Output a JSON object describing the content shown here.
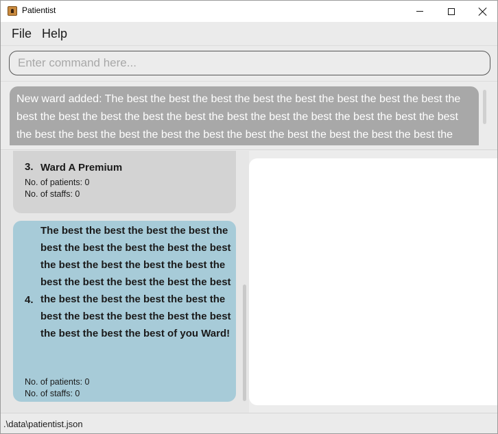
{
  "window": {
    "title": "Patientist",
    "icon": "app-icon"
  },
  "menu": {
    "file": "File",
    "help": "Help"
  },
  "command": {
    "placeholder": "Enter command here...",
    "value": ""
  },
  "result": {
    "text": "New ward added: The best the best the best the best the best the best the best the best the best the best the best the best the best the best the best the best the best the best the best the best the best the best the best the best the best the best the best the best the best the best of you Ward!"
  },
  "wards": [
    {
      "index": "3.",
      "name": "Ward A Premium",
      "patients_label": "No. of patients: 0",
      "staffs_label": "No. of staffs: 0"
    },
    {
      "index": "4.",
      "name": "The best the best the best the best the best the best the best the best the best the best the best the best the best the best the best the best the best the best the best the best the best the best the best the best the best the best the best the best the best the best of you Ward!",
      "patients_label": "No. of patients: 0",
      "staffs_label": "No. of staffs: 0"
    }
  ],
  "status": {
    "path": ".\\data\\patientist.json"
  },
  "colors": {
    "selected_card": "#a7cbd8",
    "card": "#d3d3d3",
    "result_bg": "#a8a8a8"
  }
}
